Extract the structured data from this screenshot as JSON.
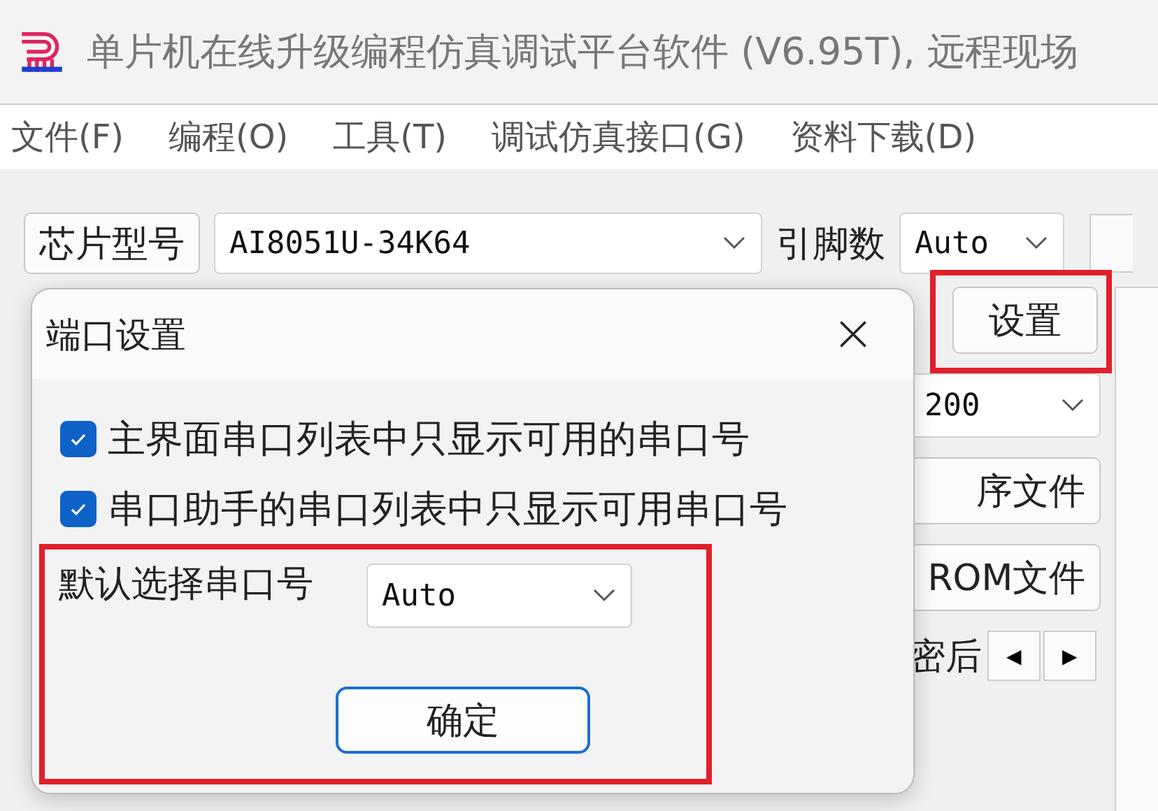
{
  "window": {
    "title": "单片机在线升级编程仿真调试平台软件 (V6.95T), 远程现场"
  },
  "menu": [
    "文件(F)",
    "编程(O)",
    "工具(T)",
    "调试仿真接口(G)",
    "资料下载(D)"
  ],
  "toolbar": {
    "chip_button": "芯片型号",
    "chip_select": "AI8051U-34K64",
    "pins_label": "引脚数",
    "pins_select": "Auto"
  },
  "background": {
    "settings_button": "设置",
    "baud_select": "200",
    "buttons": [
      "序文件",
      "ROM文件"
    ],
    "label": "密后",
    "scroll_left": "◀",
    "scroll_right": "▶"
  },
  "dialog": {
    "title": "端口设置",
    "checkboxes": [
      {
        "label": "主界面串口列表中只显示可用的串口号",
        "checked": true
      },
      {
        "label": "串口助手的串口列表中只显示可用串口号",
        "checked": true
      }
    ],
    "default_port_label": "默认选择串口号",
    "default_port_select": "Auto",
    "ok_button": "确定"
  }
}
